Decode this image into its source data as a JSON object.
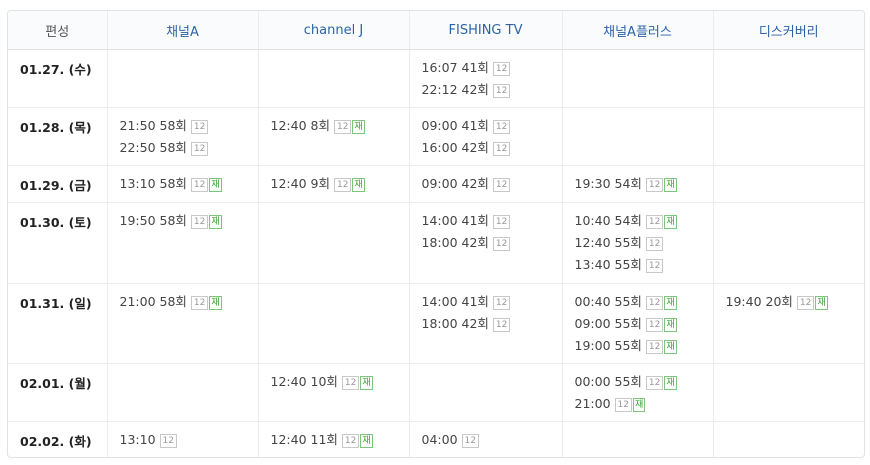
{
  "header": [
    "편성",
    "채널A",
    "channel J",
    "FISHING TV",
    "채널A플러스",
    "디스커버리"
  ],
  "badge_label": "12",
  "rerun_label": "재",
  "rows": [
    {
      "date": "01.27. (수)",
      "cells": [
        [],
        [],
        [
          {
            "time": "16:07",
            "ep": "41회",
            "rerun": false
          },
          {
            "time": "22:12",
            "ep": "42회",
            "rerun": false
          }
        ],
        [],
        []
      ]
    },
    {
      "date": "01.28. (목)",
      "cells": [
        [
          {
            "time": "21:50",
            "ep": "58회",
            "rerun": false
          },
          {
            "time": "22:50",
            "ep": "58회",
            "rerun": false
          }
        ],
        [
          {
            "time": "12:40",
            "ep": "8회",
            "rerun": true
          }
        ],
        [
          {
            "time": "09:00",
            "ep": "41회",
            "rerun": false
          },
          {
            "time": "16:00",
            "ep": "42회",
            "rerun": false
          }
        ],
        [],
        []
      ]
    },
    {
      "date": "01.29. (금)",
      "cells": [
        [
          {
            "time": "13:10",
            "ep": "58회",
            "rerun": true
          }
        ],
        [
          {
            "time": "12:40",
            "ep": "9회",
            "rerun": true
          }
        ],
        [
          {
            "time": "09:00",
            "ep": "42회",
            "rerun": false
          }
        ],
        [
          {
            "time": "19:30",
            "ep": "54회",
            "rerun": true
          }
        ],
        []
      ]
    },
    {
      "date": "01.30. (토)",
      "cells": [
        [
          {
            "time": "19:50",
            "ep": "58회",
            "rerun": true
          }
        ],
        [],
        [
          {
            "time": "14:00",
            "ep": "41회",
            "rerun": false
          },
          {
            "time": "18:00",
            "ep": "42회",
            "rerun": false
          }
        ],
        [
          {
            "time": "10:40",
            "ep": "54회",
            "rerun": true
          },
          {
            "time": "12:40",
            "ep": "55회",
            "rerun": false
          },
          {
            "time": "13:40",
            "ep": "55회",
            "rerun": false
          }
        ],
        []
      ]
    },
    {
      "date": "01.31. (일)",
      "cells": [
        [
          {
            "time": "21:00",
            "ep": "58회",
            "rerun": true
          }
        ],
        [],
        [
          {
            "time": "14:00",
            "ep": "41회",
            "rerun": false
          },
          {
            "time": "18:00",
            "ep": "42회",
            "rerun": false
          }
        ],
        [
          {
            "time": "00:40",
            "ep": "55회",
            "rerun": true
          },
          {
            "time": "09:00",
            "ep": "55회",
            "rerun": true
          },
          {
            "time": "19:00",
            "ep": "55회",
            "rerun": true
          }
        ],
        [
          {
            "time": "19:40",
            "ep": "20회",
            "rerun": true
          }
        ]
      ]
    },
    {
      "date": "02.01. (월)",
      "cells": [
        [],
        [
          {
            "time": "12:40",
            "ep": "10회",
            "rerun": true
          }
        ],
        [],
        [
          {
            "time": "00:00",
            "ep": "55회",
            "rerun": true
          },
          {
            "time": "21:00",
            "ep": "",
            "rerun": true
          }
        ],
        []
      ]
    },
    {
      "date": "02.02. (화)",
      "cells": [
        [
          {
            "time": "13:10",
            "ep": "",
            "rerun": false
          }
        ],
        [
          {
            "time": "12:40",
            "ep": "11회",
            "rerun": true
          }
        ],
        [
          {
            "time": "04:00",
            "ep": "",
            "rerun": false
          }
        ],
        [],
        []
      ]
    }
  ]
}
